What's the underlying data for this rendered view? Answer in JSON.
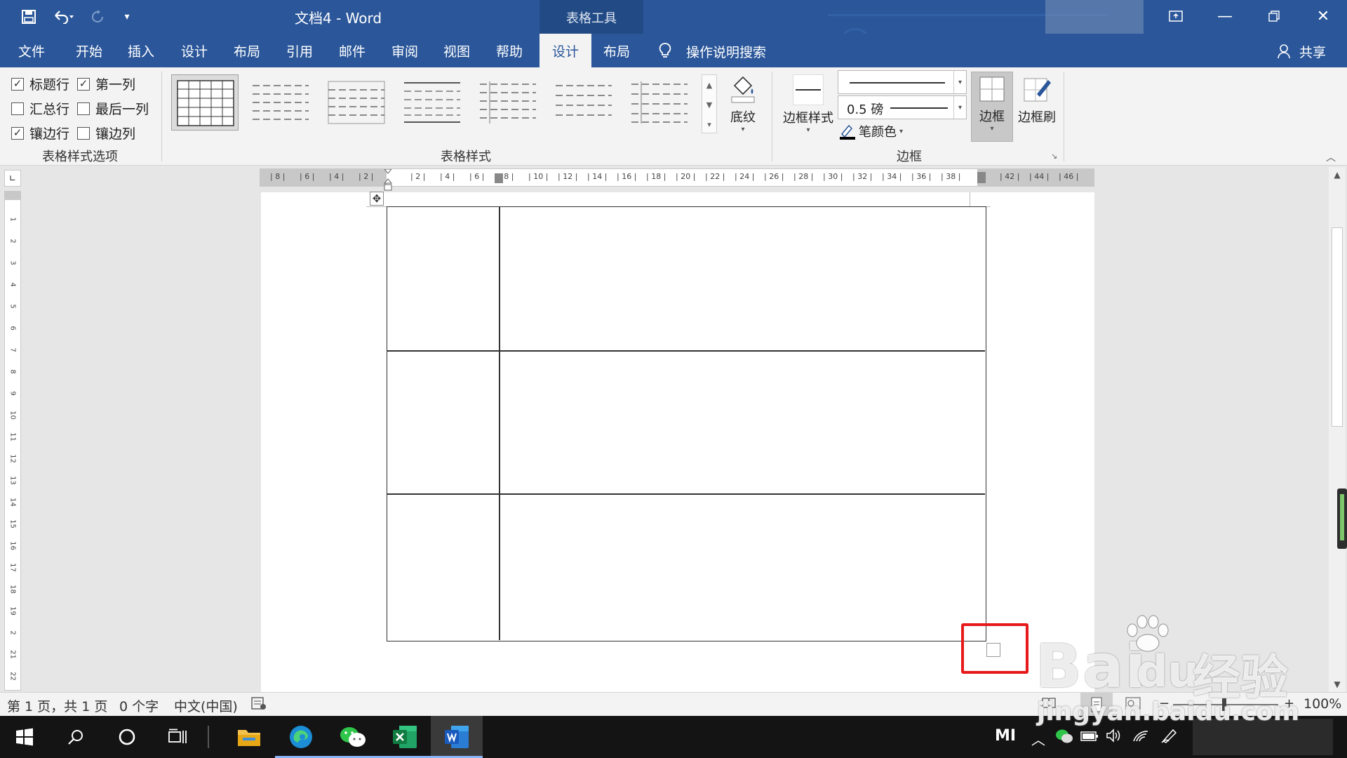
{
  "title_bar": {
    "title": "文档4  -  Word",
    "contextual_tab_group": "表格工具",
    "qa_icons": [
      "save-icon",
      "undo-icon",
      "redo-icon",
      "customize-icon"
    ],
    "window_buttons": [
      "ribbon-display-icon",
      "minimize-icon",
      "restore-icon",
      "close-icon"
    ]
  },
  "tabs": [
    {
      "label": "文件",
      "active": false
    },
    {
      "label": "开始",
      "active": false
    },
    {
      "label": "插入",
      "active": false
    },
    {
      "label": "设计",
      "active": false
    },
    {
      "label": "布局",
      "active": false
    },
    {
      "label": "引用",
      "active": false
    },
    {
      "label": "邮件",
      "active": false
    },
    {
      "label": "审阅",
      "active": false
    },
    {
      "label": "视图",
      "active": false
    },
    {
      "label": "帮助",
      "active": false
    },
    {
      "label": "设计",
      "active": true
    },
    {
      "label": "布局",
      "active": false
    }
  ],
  "tell_me": "操作说明搜索",
  "share": "共享",
  "ribbon": {
    "style_options": {
      "items": [
        {
          "label": "标题行",
          "checked": true
        },
        {
          "label": "第一列",
          "checked": true
        },
        {
          "label": "汇总行",
          "checked": false
        },
        {
          "label": "最后一列",
          "checked": false
        },
        {
          "label": "镶边行",
          "checked": true
        },
        {
          "label": "镶边列",
          "checked": false
        }
      ],
      "group_label": "表格样式选项"
    },
    "table_styles": {
      "group_label": "表格样式",
      "shading": "底纹"
    },
    "borders": {
      "border_styles": "边框样式",
      "pen_weight": "0.5 磅",
      "pen_color": "笔颜色",
      "borders_button": "边框",
      "border_painter": "边框刷",
      "group_label": "边框"
    }
  },
  "ruler": {
    "left_labels": [
      "8",
      "6",
      "4",
      "2"
    ],
    "right_labels": [
      "2",
      "4",
      "6",
      "8",
      "10",
      "12",
      "14",
      "16",
      "18",
      "20",
      "22",
      "24",
      "26",
      "28",
      "30",
      "32",
      "34",
      "36",
      "38",
      "",
      "42",
      "44",
      "46"
    ],
    "vertical_labels": [
      "1",
      "2",
      "3",
      "4",
      "5",
      "6",
      "7",
      "8",
      "9",
      "10",
      "11",
      "12",
      "13",
      "14",
      "15",
      "16",
      "17",
      "18",
      "19",
      "2",
      "21",
      "22"
    ]
  },
  "status": {
    "page": "第 1 页，共 1 页",
    "words": "0 个字",
    "language": "中文(中国)",
    "zoom": "100%"
  },
  "taskbar": {
    "apps": [
      "start-icon",
      "search-icon",
      "cortana-icon",
      "task-view-icon",
      "file-explorer-icon",
      "edge-icon",
      "wechat-icon",
      "excel-icon",
      "word-icon"
    ],
    "tray_brand": "MI"
  },
  "watermark": {
    "line1": "Bai",
    "line2": "du",
    "line3": "经验",
    "url": "jingyan.baidu.com"
  }
}
